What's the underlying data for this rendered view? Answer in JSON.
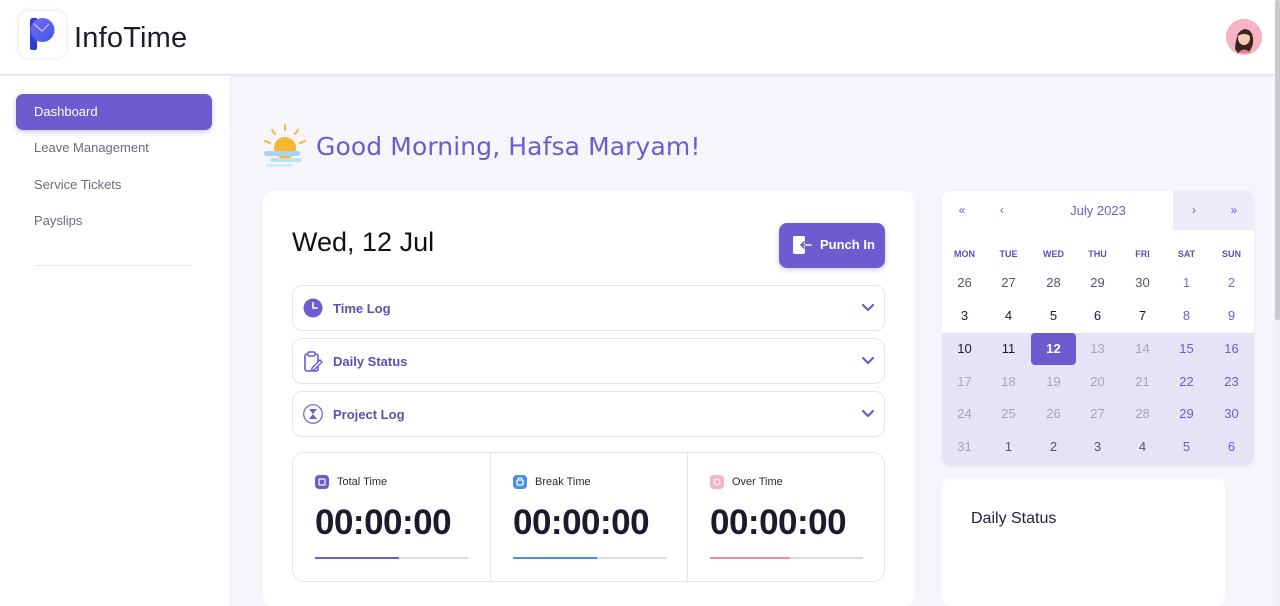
{
  "app": {
    "title": "InfoTime"
  },
  "sidebar": {
    "items": [
      {
        "label": "Dashboard",
        "active": true
      },
      {
        "label": "Leave Management",
        "active": false
      },
      {
        "label": "Service Tickets",
        "active": false
      },
      {
        "label": "Payslips",
        "active": false
      }
    ]
  },
  "greeting": {
    "text": "Good Morning, Hafsa Maryam!"
  },
  "main": {
    "date": "Wed, 12 Jul",
    "punch_label": "Punch In",
    "accordions": [
      {
        "label": "Time Log",
        "icon": "clock-icon"
      },
      {
        "label": "Daily Status",
        "icon": "clipboard-edit-icon"
      },
      {
        "label": "Project Log",
        "icon": "hourglass-icon"
      }
    ],
    "stats": [
      {
        "label": "Total Time",
        "value": "00:00:00",
        "color": "#6c5ccf",
        "progress": 0.55
      },
      {
        "label": "Break Time",
        "value": "00:00:00",
        "color": "#4a90e2",
        "progress": 0.55
      },
      {
        "label": "Over Time",
        "value": "00:00:00",
        "color": "#f28aa6",
        "progress": 0.52
      }
    ]
  },
  "calendar": {
    "month": "July 2023",
    "nav": {
      "prev_year": "«",
      "prev_month": "‹",
      "next_month": "›",
      "next_year": "»"
    },
    "weekdays": [
      "MON",
      "TUE",
      "WED",
      "THU",
      "FRI",
      "SAT",
      "SUN"
    ],
    "weeks": [
      [
        "26",
        "27",
        "28",
        "29",
        "30",
        "1",
        "2"
      ],
      [
        "3",
        "4",
        "5",
        "6",
        "7",
        "8",
        "9"
      ],
      [
        "10",
        "11",
        "12",
        "13",
        "14",
        "15",
        "16"
      ],
      [
        "17",
        "18",
        "19",
        "20",
        "21",
        "22",
        "23"
      ],
      [
        "24",
        "25",
        "26",
        "27",
        "28",
        "29",
        "30"
      ],
      [
        "31",
        "1",
        "2",
        "3",
        "4",
        "5",
        "6"
      ]
    ],
    "selected": "12"
  },
  "status_card": {
    "title": "Daily Status"
  },
  "colors": {
    "accent": "#6c5ccf",
    "weekend": "#6c5ccf",
    "muted": "#a7a5b5"
  }
}
